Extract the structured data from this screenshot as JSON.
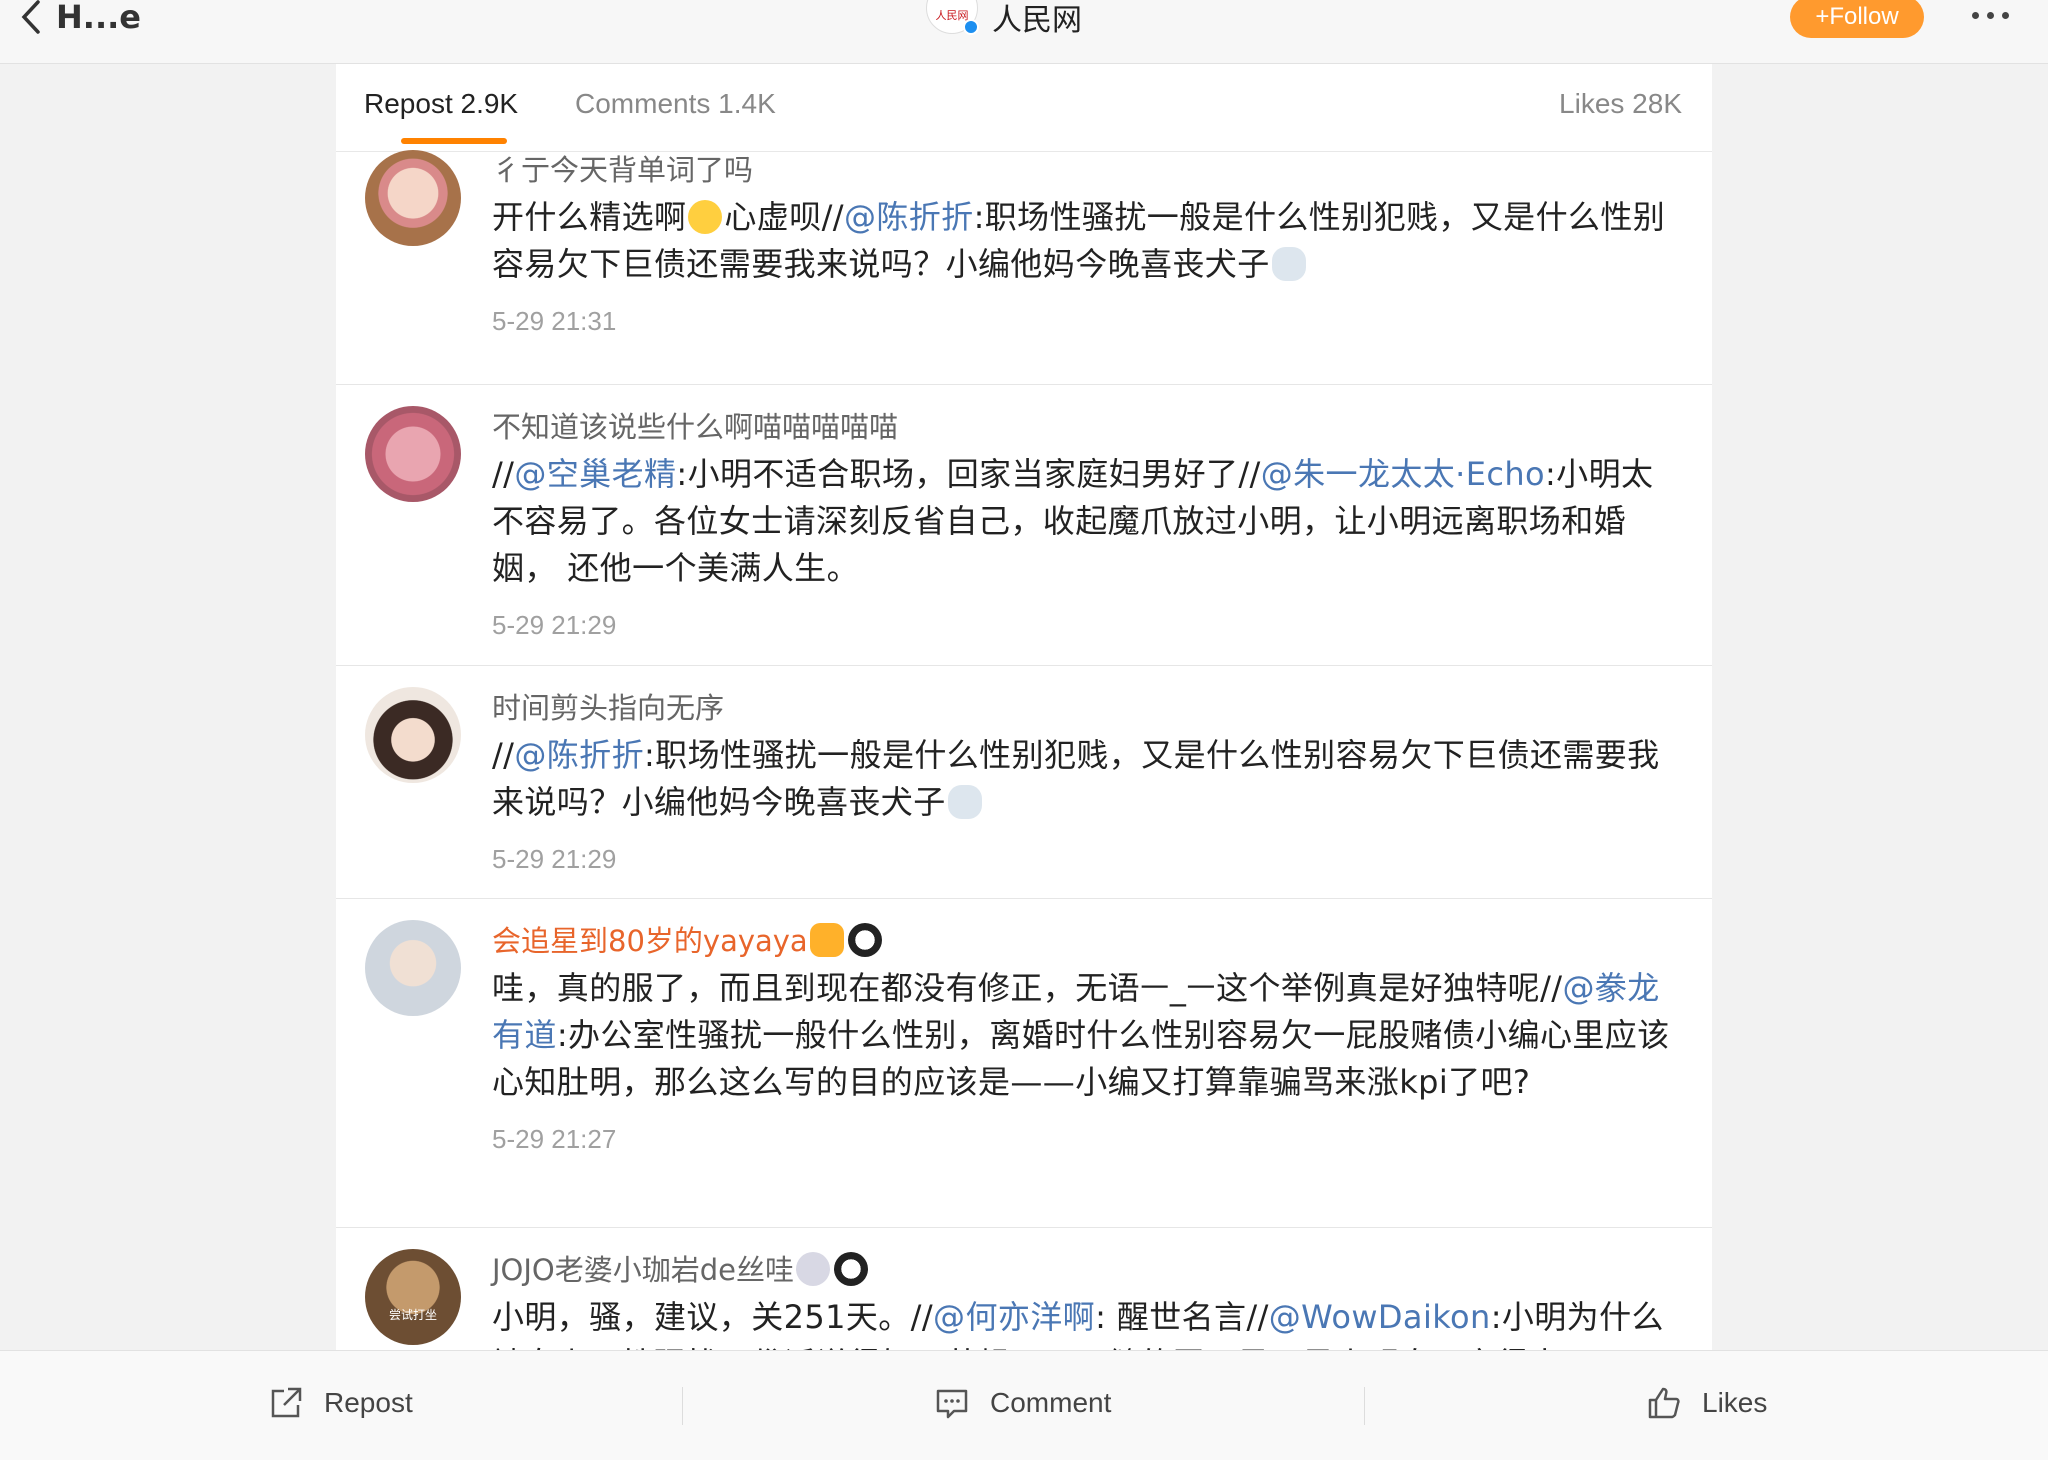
{
  "nav": {
    "back_label": "H...e",
    "account_name": "人民网",
    "account_logo_text": "人民网",
    "follow_label": "+Follow"
  },
  "tabs": {
    "repost": "Repost 2.9K",
    "comments": "Comments 1.4K",
    "likes": "Likes 28K"
  },
  "posts": [
    {
      "user": "彳亍今天背单词了吗",
      "segments": [
        "开什么精选啊",
        "心虚呗//",
        "@陈折折",
        ":职场性骚扰一般是什么性别犯贱，又是什么性别容易欠下巨债还需要我来说吗？小编他妈今晚喜丧犬子"
      ],
      "time": "5-29 21:31"
    },
    {
      "user": "不知道该说些什么啊喵喵喵喵喵",
      "segments": [
        "//",
        "@空巢老精",
        ":小明不适合职场，回家当家庭妇男好了//",
        "@朱一龙太太·Echo",
        ":小明太不容易了。各位女士请深刻反省自己，收起魔爪放过小明，让小明远离职场和婚姻， 还他一个美满人生。"
      ],
      "time": "5-29 21:29"
    },
    {
      "user": "时间剪头指向无序",
      "segments": [
        "//",
        "@陈折折",
        ":职场性骚扰一般是什么性别犯贱，又是什么性别容易欠下巨债还需要我来说吗？小编他妈今晚喜丧犬子"
      ],
      "time": "5-29 21:29"
    },
    {
      "user": "会追星到80岁的yayaya",
      "segments": [
        "哇，真的服了，而且到现在都没有修正，无语ㅡ_ㅡ这个举例真是好独特呢//",
        "@豢龙有道",
        ":办公室性骚扰一般什么性别，离婚时什么性别容易欠一屁股赌债小编心里应该心知肚明，那么这么写的目的应该是——小编又打算靠骗骂来涨kpi了吧?"
      ],
      "time": "5-29 21:27"
    },
    {
      "user": "JOJO老婆小珈岩de丝哇",
      "avatar_text": "尝试打坐",
      "segments": [
        "小明，骚，建议，关251天。//",
        "@何亦洋啊",
        ": 醒世名言//",
        "@WowDaikon",
        ":小明为什么被女上司性骚扰？俗话说得好，苍蝇不叮无缝的蛋，是不是小明自己穿得太"
      ],
      "time": ""
    }
  ],
  "bottom": {
    "repost": "Repost",
    "comment": "Comment",
    "likes": "Likes"
  },
  "colors": {
    "accent": "#ff8200",
    "follow": "#ff9a2e",
    "mention": "#4a77b4",
    "vip_name": "#e8652b"
  }
}
